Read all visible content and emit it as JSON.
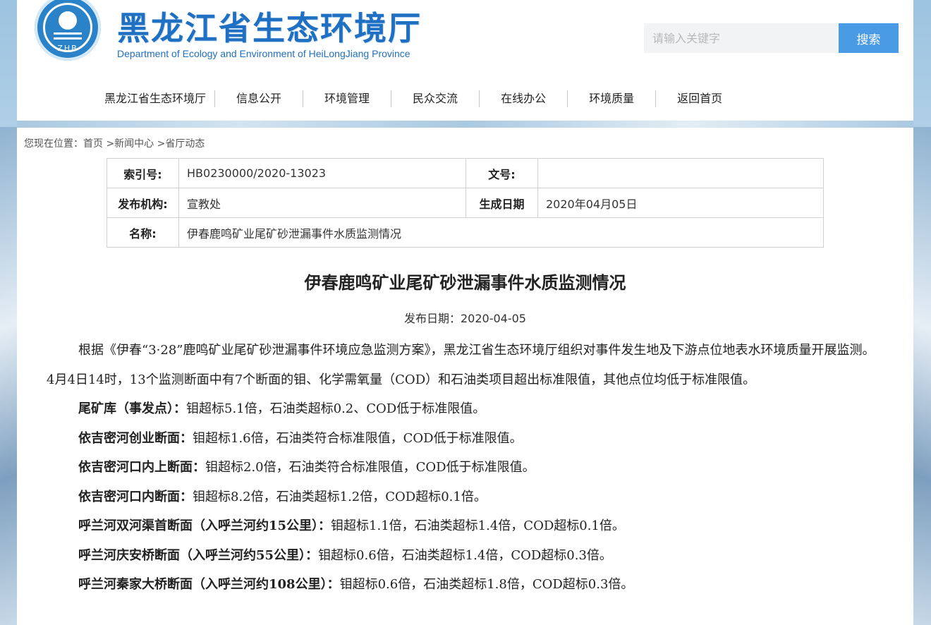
{
  "site": {
    "title": "黑龙江省生态环境厅",
    "subtitle": "Department of Ecology and Environment  of HeiLongJiang Province",
    "logo_text": "ZHB"
  },
  "search": {
    "placeholder": "请输入关键字",
    "button_label": "搜索"
  },
  "nav": {
    "items": [
      "黑龙江省生态环境厅",
      "信息公开",
      "环境管理",
      "民众交流",
      "在线办公",
      "环境质量",
      "返回首页"
    ]
  },
  "breadcrumb": {
    "prefix": "您现在位置：",
    "items": [
      "首页",
      " >新闻中心",
      " >省厅动态"
    ]
  },
  "meta": {
    "index_label": "索引号:",
    "index_value": "HB0230000/2020-13023",
    "docno_label": "文号:",
    "docno_value": "",
    "org_label": "发布机构:",
    "org_value": "宣教处",
    "date_label": "生成日期",
    "date_value": "2020年04月05日",
    "name_label": "名称:",
    "name_value": "伊春鹿鸣矿业尾矿砂泄漏事件水质监测情况"
  },
  "article": {
    "title": "伊春鹿鸣矿业尾矿砂泄漏事件水质监测情况",
    "publish_date": "发布日期：2020-04-05",
    "lead": "根据《伊春“3·28”鹿鸣矿业尾矿砂泄漏事件环境应急监测方案》，黑龙江省生态环境厅组织对事件发生地及下游点位地表水环境质量开展监测。4月4日14时，13个监测断面中有7个断面的钼、化学需氧量（COD）和石油类项目超出标准限值，其他点位均低于标准限值。",
    "items": [
      {
        "label": "尾矿库（事发点）：",
        "text": "钼超标5.1倍，石油类超标0.2、COD低于标准限值。"
      },
      {
        "label": "依吉密河创业断面：",
        "text": "钼超标1.6倍，石油类符合标准限值，COD低于标准限值。"
      },
      {
        "label": "依吉密河口内上断面：",
        "text": "钼超标2.0倍，石油类符合标准限值，COD低于标准限值。"
      },
      {
        "label": "依吉密河口内断面：",
        "text": "钼超标8.2倍，石油类超标1.2倍，COD超标0.1倍。"
      },
      {
        "label": "呼兰河双河渠首断面（入呼兰河约15公里）：",
        "text": "钼超标1.1倍，石油类超标1.4倍，COD超标0.1倍。"
      },
      {
        "label": "呼兰河庆安桥断面（入呼兰河约55公里）：",
        "text": "钼超标0.6倍，石油类超标1.4倍，COD超标0.3倍。"
      },
      {
        "label": "呼兰河秦家大桥断面（入呼兰河约108公里）：",
        "text": "钼超标0.6倍，石油类超标1.8倍，COD超标0.3倍。"
      }
    ]
  },
  "colors": {
    "brand_blue": "#1f6fc2",
    "search_button": "#4a9be6"
  }
}
